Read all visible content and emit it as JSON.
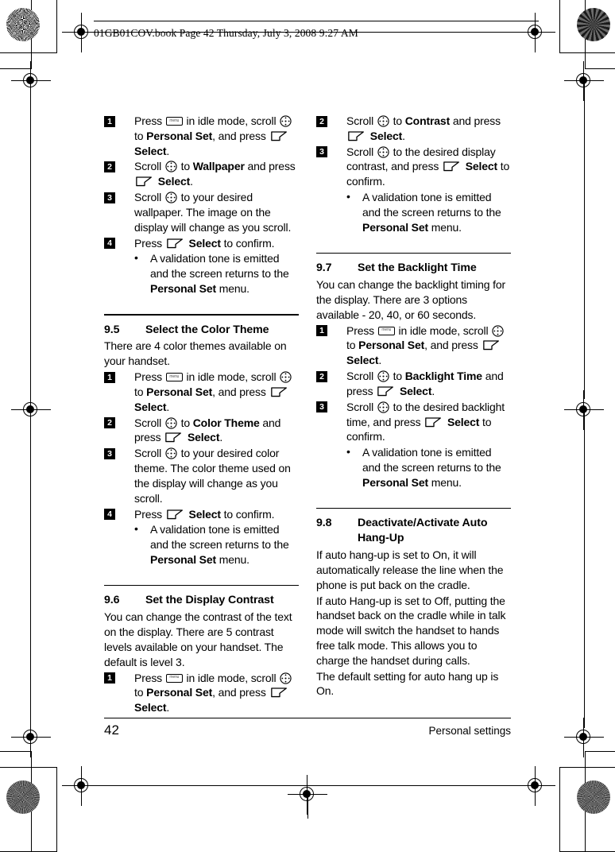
{
  "header": {
    "text": "01GB01COV.book  Page 42  Thursday, July 3, 2008  9:27 AM"
  },
  "icons": {
    "menu_key": "menu-key-icon",
    "nav_key": "navigation-scroll-key-icon",
    "soft_key": "soft-key-select-icon",
    "rosette": "print-rosette-icon",
    "registration_target": "registration-target-icon"
  },
  "left_column": {
    "steps_wallpaper": [
      {
        "number": "1",
        "parts": [
          {
            "t": "Press ",
            "b": false
          },
          {
            "icon": "menu"
          },
          {
            "t": " in idle mode, scroll ",
            "b": false
          },
          {
            "icon": "nav"
          },
          {
            "t": " to ",
            "b": false
          },
          {
            "t": "Personal Set",
            "b": true
          },
          {
            "t": ", and press ",
            "b": false
          },
          {
            "icon": "soft"
          },
          {
            "t": " ",
            "b": false
          },
          {
            "t": "Select",
            "b": true
          },
          {
            "t": ".",
            "b": false
          }
        ]
      },
      {
        "number": "2",
        "parts": [
          {
            "t": "Scroll ",
            "b": false
          },
          {
            "icon": "nav"
          },
          {
            "t": " to ",
            "b": false
          },
          {
            "t": "Wallpaper",
            "b": true
          },
          {
            "t": " and press ",
            "b": false
          },
          {
            "icon": "soft"
          },
          {
            "t": " ",
            "b": false
          },
          {
            "t": "Select",
            "b": true
          },
          {
            "t": ".",
            "b": false
          }
        ]
      },
      {
        "number": "3",
        "parts": [
          {
            "t": "Scroll ",
            "b": false
          },
          {
            "icon": "nav"
          },
          {
            "t": " to your desired wallpaper. The image on the display will change as you scroll.",
            "b": false
          }
        ]
      },
      {
        "number": "4",
        "parts": [
          {
            "t": "Press ",
            "b": false
          },
          {
            "icon": "soft"
          },
          {
            "t": " ",
            "b": false
          },
          {
            "t": "Select",
            "b": true
          },
          {
            "t": " to confirm.",
            "b": false
          }
        ]
      }
    ],
    "bullet_wallpaper": [
      {
        "t": "A validation tone is emitted and the screen returns to the ",
        "b": false
      },
      {
        "t": "Personal Set",
        "b": true
      },
      {
        "t": " menu.",
        "b": false
      }
    ],
    "section_95": {
      "number": "9.5",
      "title": "Select the Color Theme",
      "intro": "There are 4 color themes available on your handset.",
      "steps": [
        {
          "number": "1",
          "parts": [
            {
              "t": "Press ",
              "b": false
            },
            {
              "icon": "menu"
            },
            {
              "t": " in idle mode, scroll ",
              "b": false
            },
            {
              "icon": "nav"
            },
            {
              "t": " to ",
              "b": false
            },
            {
              "t": "Personal Set",
              "b": true
            },
            {
              "t": ", and press ",
              "b": false
            },
            {
              "icon": "soft"
            },
            {
              "t": " ",
              "b": false
            },
            {
              "t": "Select",
              "b": true
            },
            {
              "t": ".",
              "b": false
            }
          ]
        },
        {
          "number": "2",
          "parts": [
            {
              "t": "Scroll ",
              "b": false
            },
            {
              "icon": "nav"
            },
            {
              "t": " to ",
              "b": false
            },
            {
              "t": "Color Theme",
              "b": true
            },
            {
              "t": " and press ",
              "b": false
            },
            {
              "icon": "soft"
            },
            {
              "t": " ",
              "b": false
            },
            {
              "t": "Select",
              "b": true
            },
            {
              "t": ".",
              "b": false
            }
          ]
        },
        {
          "number": "3",
          "parts": [
            {
              "t": "Scroll ",
              "b": false
            },
            {
              "icon": "nav"
            },
            {
              "t": " to your desired color theme. The color theme used on the display will change as you scroll.",
              "b": false
            }
          ]
        },
        {
          "number": "4",
          "parts": [
            {
              "t": "Press ",
              "b": false
            },
            {
              "icon": "soft"
            },
            {
              "t": " ",
              "b": false
            },
            {
              "t": "Select",
              "b": true
            },
            {
              "t": " to confirm.",
              "b": false
            }
          ]
        }
      ],
      "bullet": [
        {
          "t": "A validation tone is emitted and the screen returns to the ",
          "b": false
        },
        {
          "t": "Personal Set",
          "b": true
        },
        {
          "t": " menu.",
          "b": false
        }
      ]
    },
    "section_96": {
      "number": "9.6",
      "title": "Set the Display Contrast",
      "intro": "You can change the contrast of the text on the display. There are 5 contrast levels available on your handset. The default is level 3.",
      "steps": [
        {
          "number": "1",
          "parts": [
            {
              "t": "Press ",
              "b": false
            },
            {
              "icon": "menu"
            },
            {
              "t": " in idle mode, scroll ",
              "b": false
            },
            {
              "icon": "nav"
            },
            {
              "t": " to ",
              "b": false
            },
            {
              "t": "Personal Set",
              "b": true
            },
            {
              "t": ", and press ",
              "b": false
            },
            {
              "icon": "soft"
            },
            {
              "t": " ",
              "b": false
            },
            {
              "t": "Select",
              "b": true
            },
            {
              "t": ".",
              "b": false
            }
          ]
        }
      ]
    }
  },
  "right_column": {
    "steps_contrast": [
      {
        "number": "2",
        "parts": [
          {
            "t": "Scroll ",
            "b": false
          },
          {
            "icon": "nav"
          },
          {
            "t": " to ",
            "b": false
          },
          {
            "t": "Contrast",
            "b": true
          },
          {
            "t": " and press ",
            "b": false
          },
          {
            "icon": "soft"
          },
          {
            "t": " ",
            "b": false
          },
          {
            "t": "Select",
            "b": true
          },
          {
            "t": ".",
            "b": false
          }
        ]
      },
      {
        "number": "3",
        "parts": [
          {
            "t": "Scroll ",
            "b": false
          },
          {
            "icon": "nav"
          },
          {
            "t": " to the desired display contrast, and press ",
            "b": false
          },
          {
            "icon": "soft"
          },
          {
            "t": " ",
            "b": false
          },
          {
            "t": "Select",
            "b": true
          },
          {
            "t": " to confirm.",
            "b": false
          }
        ]
      }
    ],
    "bullet_contrast": [
      {
        "t": "A validation tone is emitted and the screen returns to the ",
        "b": false
      },
      {
        "t": "Personal Set",
        "b": true
      },
      {
        "t": " menu.",
        "b": false
      }
    ],
    "section_97": {
      "number": "9.7",
      "title": "Set the Backlight Time",
      "intro": "You can change the backlight timing for the display. There are 3 options available - 20, 40, or 60 seconds.",
      "steps": [
        {
          "number": "1",
          "parts": [
            {
              "t": "Press ",
              "b": false
            },
            {
              "icon": "menu"
            },
            {
              "t": " in idle mode, scroll ",
              "b": false
            },
            {
              "icon": "nav"
            },
            {
              "t": " to ",
              "b": false
            },
            {
              "t": "Personal Set",
              "b": true
            },
            {
              "t": ", and press ",
              "b": false
            },
            {
              "icon": "soft"
            },
            {
              "t": " ",
              "b": false
            },
            {
              "t": "Select",
              "b": true
            },
            {
              "t": ".",
              "b": false
            }
          ]
        },
        {
          "number": "2",
          "parts": [
            {
              "t": "Scroll ",
              "b": false
            },
            {
              "icon": "nav"
            },
            {
              "t": " to ",
              "b": false
            },
            {
              "t": "Backlight Time",
              "b": true
            },
            {
              "t": " and press ",
              "b": false
            },
            {
              "icon": "soft"
            },
            {
              "t": " ",
              "b": false
            },
            {
              "t": "Select",
              "b": true
            },
            {
              "t": ".",
              "b": false
            }
          ]
        },
        {
          "number": "3",
          "parts": [
            {
              "t": "Scroll ",
              "b": false
            },
            {
              "icon": "nav"
            },
            {
              "t": " to the desired backlight time, and press ",
              "b": false
            },
            {
              "icon": "soft"
            },
            {
              "t": " ",
              "b": false
            },
            {
              "t": "Select",
              "b": true
            },
            {
              "t": " to confirm.",
              "b": false
            }
          ]
        }
      ],
      "bullet": [
        {
          "t": "A validation tone is emitted and the screen returns to the ",
          "b": false
        },
        {
          "t": "Personal Set",
          "b": true
        },
        {
          "t": " menu.",
          "b": false
        }
      ]
    },
    "section_98": {
      "number": "9.8",
      "title_line1": "Deactivate/Activate Auto",
      "title_line2": "Hang-Up",
      "paragraphs": [
        "If auto hang-up is set to On, it will automatically release the line when the phone is put back on the cradle.",
        "If auto Hang-up is set to Off, putting the handset back on the cradle while in talk mode will switch the handset to hands free talk mode. This allows you to charge the handset during calls.",
        "The default setting for auto hang up is On."
      ]
    }
  },
  "footer": {
    "page_number": "42",
    "label": "Personal settings"
  }
}
